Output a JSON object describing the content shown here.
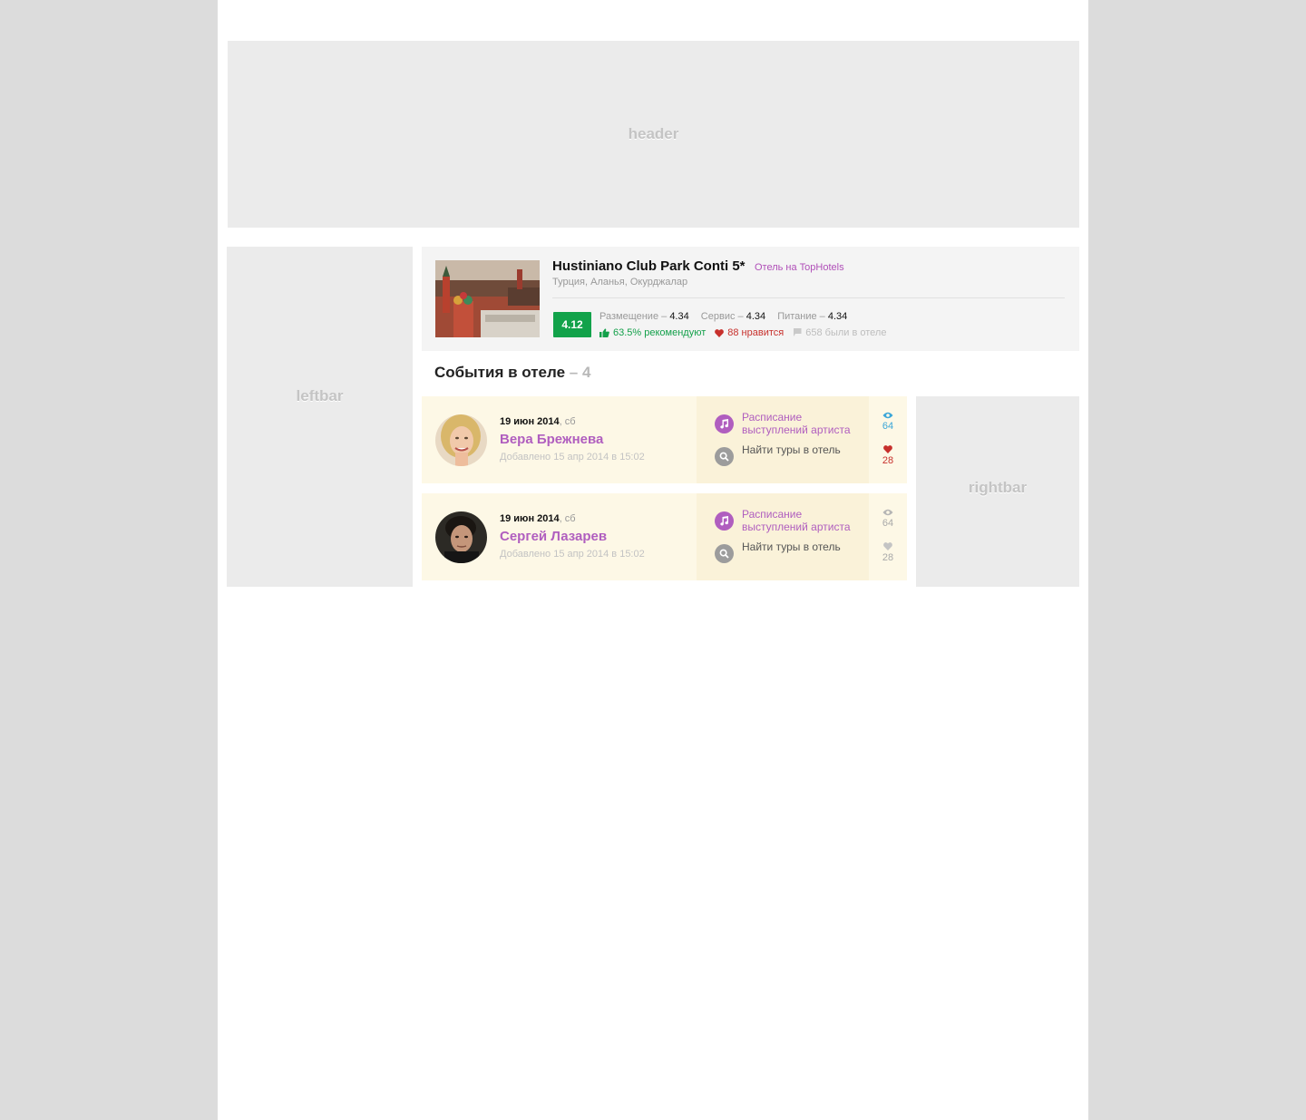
{
  "placeholders": {
    "header": "header",
    "leftbar": "leftbar",
    "rightbar": "rightbar"
  },
  "hotel": {
    "name": "Hustiniano Club Park Conti 5*",
    "tag": "Отель на TopHotels",
    "location": "Турция, Аланья, Окурджалар",
    "score": "4.12",
    "ratings": [
      {
        "label": "Размещение",
        "value": "4.34"
      },
      {
        "label": "Сервис",
        "value": "4.34"
      },
      {
        "label": "Питание",
        "value": "4.34"
      }
    ],
    "stats": {
      "recommend": "63.5% рекомендуют",
      "likes": "88 нравится",
      "visited": "658 были в отеле"
    },
    "colors": {
      "score_bg": "#12a24a",
      "accent": "#b05ebf"
    }
  },
  "events": {
    "title": "События в отеле",
    "count": "– 4",
    "items": [
      {
        "date": "19 июн 2014",
        "day": "сб",
        "name": "Вера Брежнева",
        "added": "Добавлено 15 апр 2014 в 15:02",
        "action_schedule": "Расписание выступлений артиста",
        "action_tours": "Найти туры в отель",
        "views": "64",
        "likes": "28"
      },
      {
        "date": "19 июн 2014",
        "day": "сб",
        "name": "Сергей Лазарев",
        "added": "Добавлено 15 апр 2014 в 15:02",
        "action_schedule": "Расписание выступлений артиста",
        "action_tours": "Найти туры в отель",
        "views": "64",
        "likes": "28"
      }
    ]
  }
}
